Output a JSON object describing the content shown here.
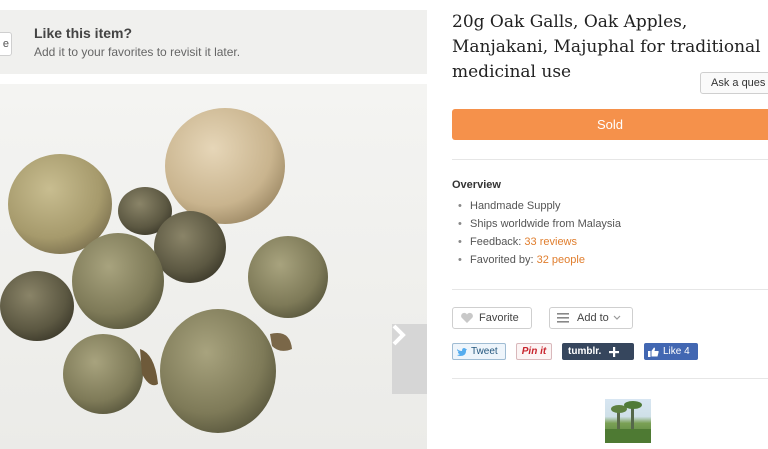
{
  "favorites_banner": {
    "button_stub": "e",
    "title": "Like this item?",
    "subtitle": "Add it to your favorites to revisit it later."
  },
  "listing": {
    "title": "20g Oak Galls, Oak Apples, Manjakani, Majuphal for traditional medicinal use",
    "ask_button": "Ask a ques",
    "sold_label": "Sold"
  },
  "overview": {
    "heading": "Overview",
    "item1": "Handmade Supply",
    "item2": "Ships worldwide from Malaysia",
    "item3_prefix": "Feedback: ",
    "item3_link": "33 reviews",
    "item4_prefix": "Favorited by: ",
    "item4_link": "32 people"
  },
  "actions": {
    "favorite": "Favorite",
    "add_to": "Add to"
  },
  "share": {
    "tweet": "Tweet",
    "pinit": "Pin it",
    "tumblr": "tumblr.",
    "like": "Like 4"
  },
  "colors": {
    "sold": "#f5914b",
    "link": "#e07e2e",
    "tumblr": "#36465d",
    "facebook": "#4267b2"
  },
  "icons": [
    "heart-icon",
    "list-icon",
    "caret-down-icon",
    "twitter-bird-icon",
    "plus-icon",
    "thumbs-up-icon",
    "chevron-right-icon"
  ]
}
